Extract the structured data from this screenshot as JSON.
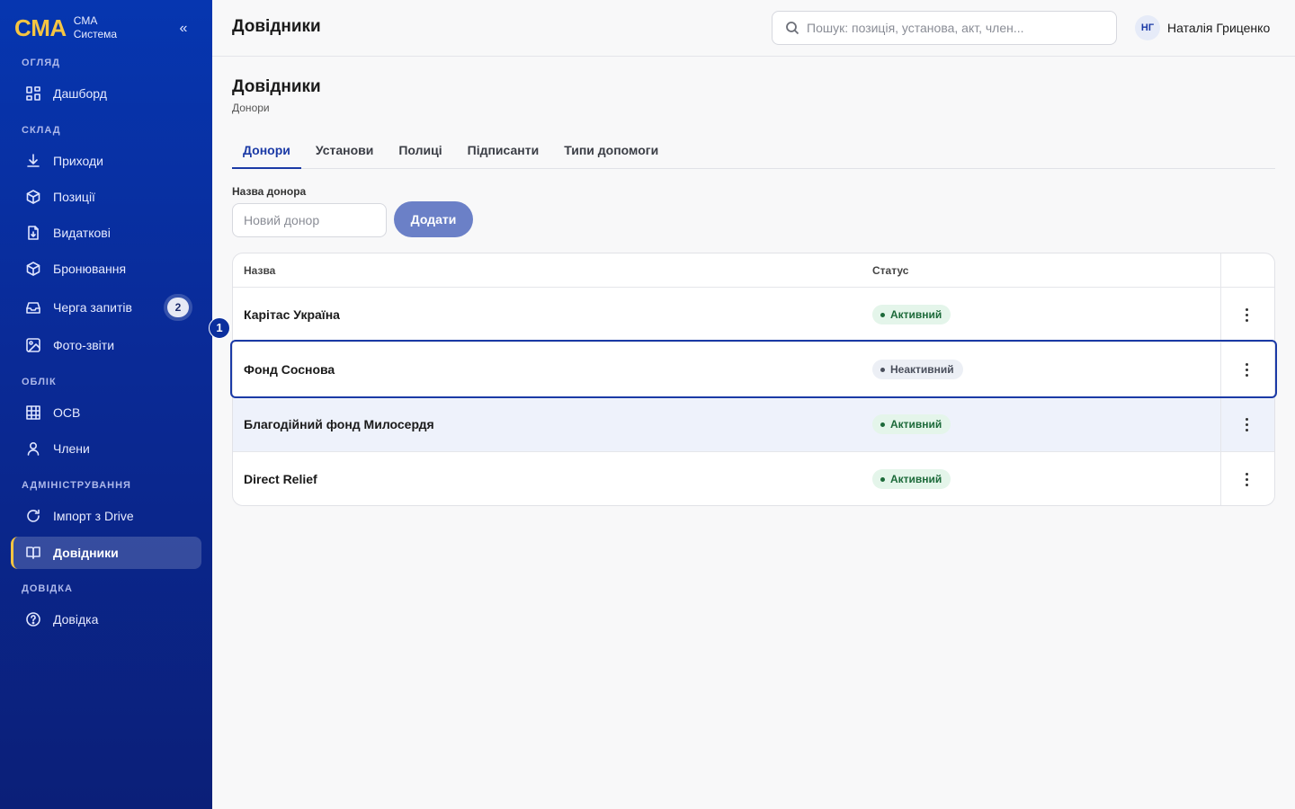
{
  "brand": {
    "logo": "CMA",
    "line1": "CMA",
    "line2": "Система",
    "collapse": "«"
  },
  "sidebar": {
    "sections": [
      {
        "label": "ОГЛЯД"
      },
      {
        "label": "СКЛАД"
      },
      {
        "label": "ОБЛІК"
      },
      {
        "label": "АДМІНІСТРУВАННЯ"
      },
      {
        "label": "ДОВІДКА"
      }
    ],
    "items": [
      {
        "label": "Дашборд",
        "icon": "dashboard-icon"
      },
      {
        "label": "Приходи",
        "icon": "download-icon"
      },
      {
        "label": "Позиції",
        "icon": "box-icon"
      },
      {
        "label": "Видаткові",
        "icon": "document-icon"
      },
      {
        "label": "Бронювання",
        "icon": "box-icon"
      },
      {
        "label": "Черга запитів",
        "icon": "inbox-icon",
        "badge": "2"
      },
      {
        "label": "Фото-звіти",
        "icon": "image-icon"
      },
      {
        "label": "ОСВ",
        "icon": "table-icon"
      },
      {
        "label": "Члени",
        "icon": "user-icon"
      },
      {
        "label": "Імпорт з Drive",
        "icon": "refresh-icon"
      },
      {
        "label": "Довідники",
        "icon": "book-icon",
        "active": true
      },
      {
        "label": "Довідка",
        "icon": "help-icon"
      }
    ]
  },
  "header": {
    "title": "Довідники",
    "search_placeholder": "Пошук: позиція, установа, акт, член...",
    "user_initials": "НГ",
    "user_name": "Наталія Гриценко"
  },
  "page": {
    "title": "Довідники",
    "subtitle": "Донори",
    "tabs": [
      {
        "label": "Донори",
        "active": true
      },
      {
        "label": "Установи"
      },
      {
        "label": "Полиці"
      },
      {
        "label": "Підписанти"
      },
      {
        "label": "Типи допомоги"
      }
    ],
    "form": {
      "label": "Назва донора",
      "placeholder": "Новий донор",
      "value": "",
      "button": "Додати"
    },
    "table": {
      "headers": {
        "name": "Назва",
        "status": "Статус"
      },
      "rows": [
        {
          "name": "Карітас Україна",
          "status": "Активний",
          "active": true
        },
        {
          "name": "Фонд Соснова",
          "status": "Неактивний",
          "active": false
        },
        {
          "name": "Благодійний фонд Милосердя",
          "status": "Активний",
          "active": true
        },
        {
          "name": "Direct Relief",
          "status": "Активний",
          "active": true
        }
      ]
    },
    "step_marker": "1"
  },
  "colors": {
    "sidebar_top": "#0636b0",
    "sidebar_bottom": "#0b1f78",
    "brand_yellow": "#f5c542",
    "accent": "#1b3aa6",
    "add_button": "#6b80c7",
    "active_badge": "#e4f5ea",
    "inactive_badge": "#eceff5"
  }
}
